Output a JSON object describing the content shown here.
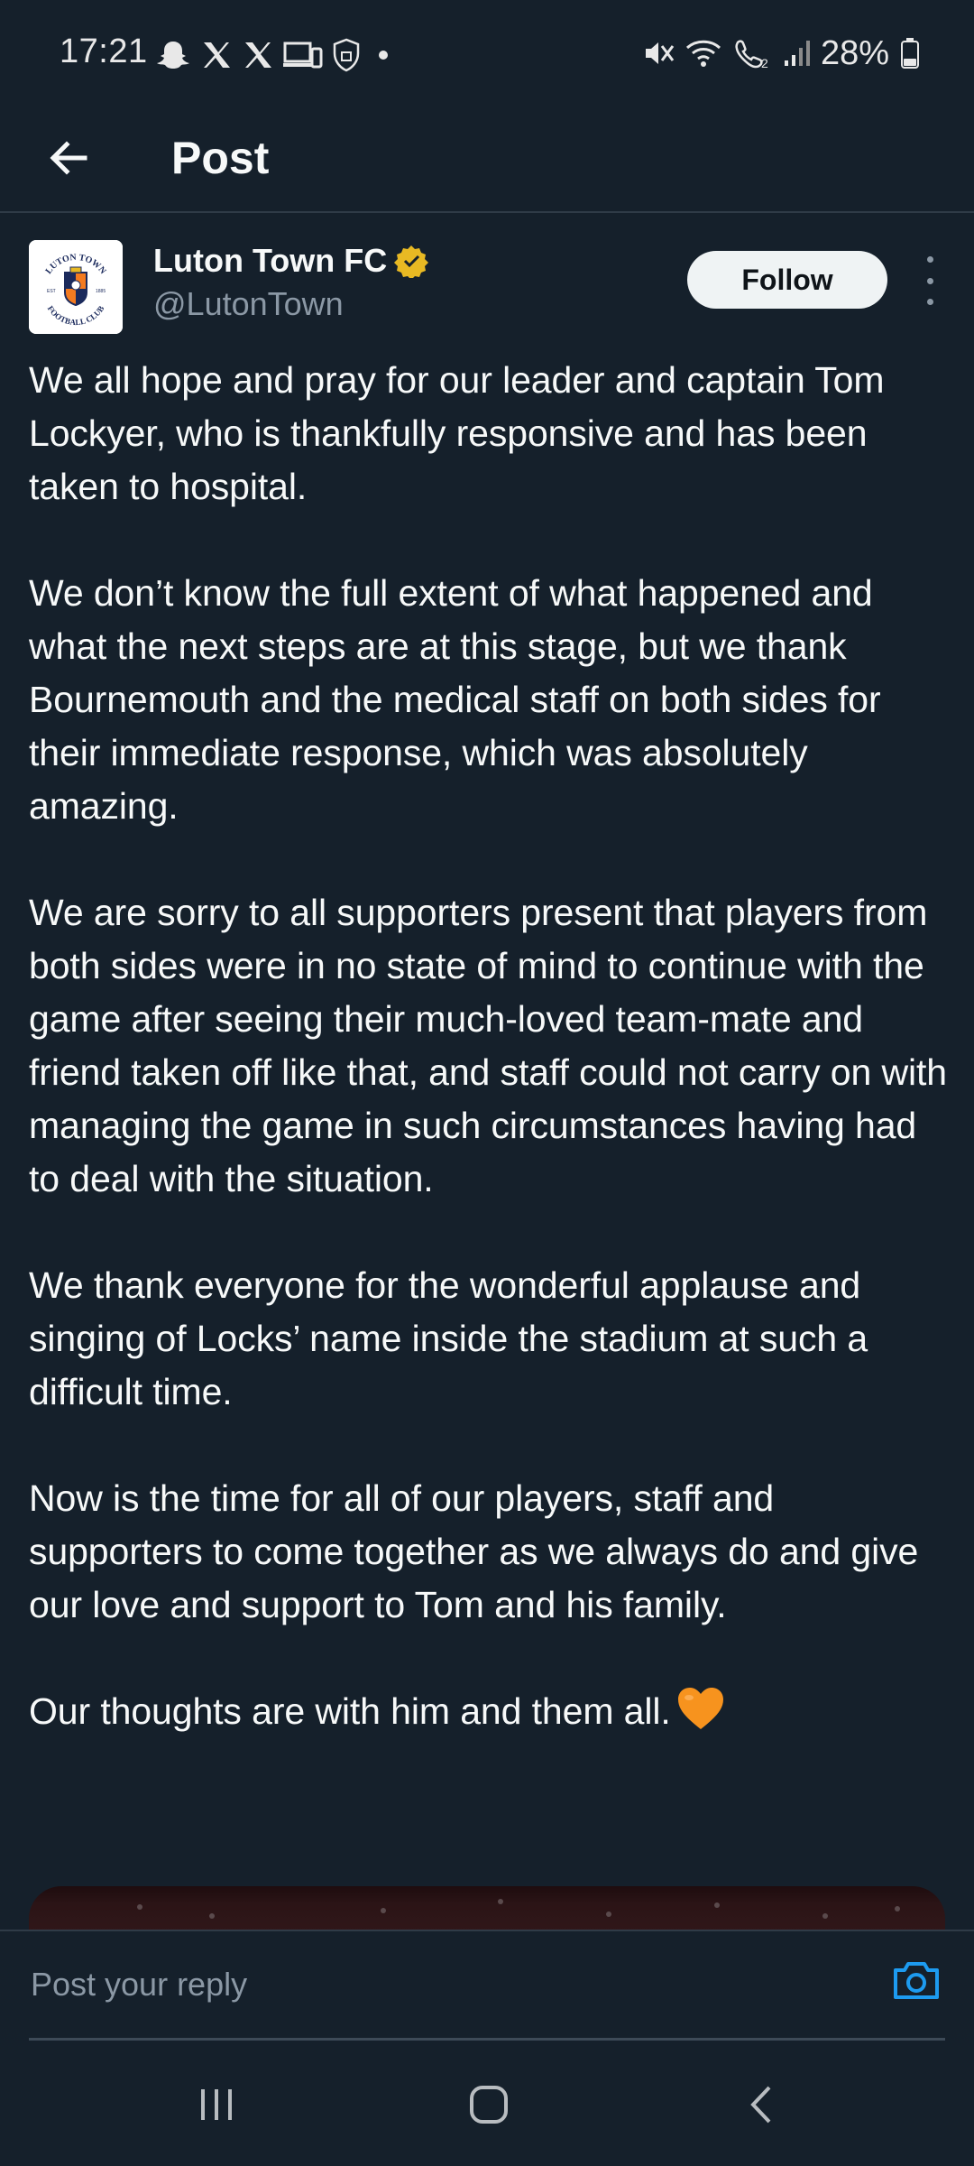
{
  "status_bar": {
    "time": "17:21",
    "battery": "28%",
    "left_icons": [
      "snapchat-icon",
      "x-icon",
      "x-icon",
      "devices-icon",
      "shield-icon",
      "dot-icon"
    ],
    "right_icons": [
      "mute-icon",
      "wifi-icon",
      "wifi-calling-icon",
      "signal-icon",
      "battery-icon"
    ]
  },
  "header": {
    "title": "Post",
    "back_icon": "arrow-left-icon"
  },
  "author": {
    "display_name": "Luton Town FC",
    "handle": "@LutonTown",
    "verified": true,
    "verified_color": "#e8b923",
    "avatar_text_top": "LUTON TOWN",
    "avatar_text_bottom": "FOOTBALL CLUB",
    "avatar_est": "EST",
    "avatar_year": "1885",
    "follow_label": "Follow"
  },
  "post": {
    "paragraphs": [
      "We all hope and pray for our leader and captain Tom Lockyer, who is thankfully responsive and has been taken to hospital.",
      "We don’t know the full extent of what happened and what the next steps are at this stage, but we thank Bournemouth and the medical staff on both sides for their immediate response, which was absolutely amazing.",
      "We are sorry to all supporters present that players from both sides were in no state of mind to continue with the game after seeing their much-loved team-mate and friend taken off like that, and staff could not carry on with managing the game in such circumstances having had to deal with the situation.",
      "We thank everyone for the wonderful applause and singing of Locks’ name inside the stadium at such a difficult time.",
      "Now is the time for all of our players, staff and supporters to come together as we always do and give our love and support to Tom and his family.",
      "Our thoughts are with him and them all."
    ],
    "heart_emoji": "orange-heart-icon",
    "heart_color": "#f7931e"
  },
  "reply": {
    "placeholder": "Post your reply",
    "camera_icon": "camera-icon",
    "accent": "#1d9bf0"
  },
  "nav": {
    "recents_icon": "recents-icon",
    "home_icon": "home-icon",
    "back_icon": "back-icon"
  },
  "colors": {
    "background": "#15202b",
    "text": "#f7f9f9",
    "muted": "#8b98a5",
    "divider": "#2f3b47"
  }
}
